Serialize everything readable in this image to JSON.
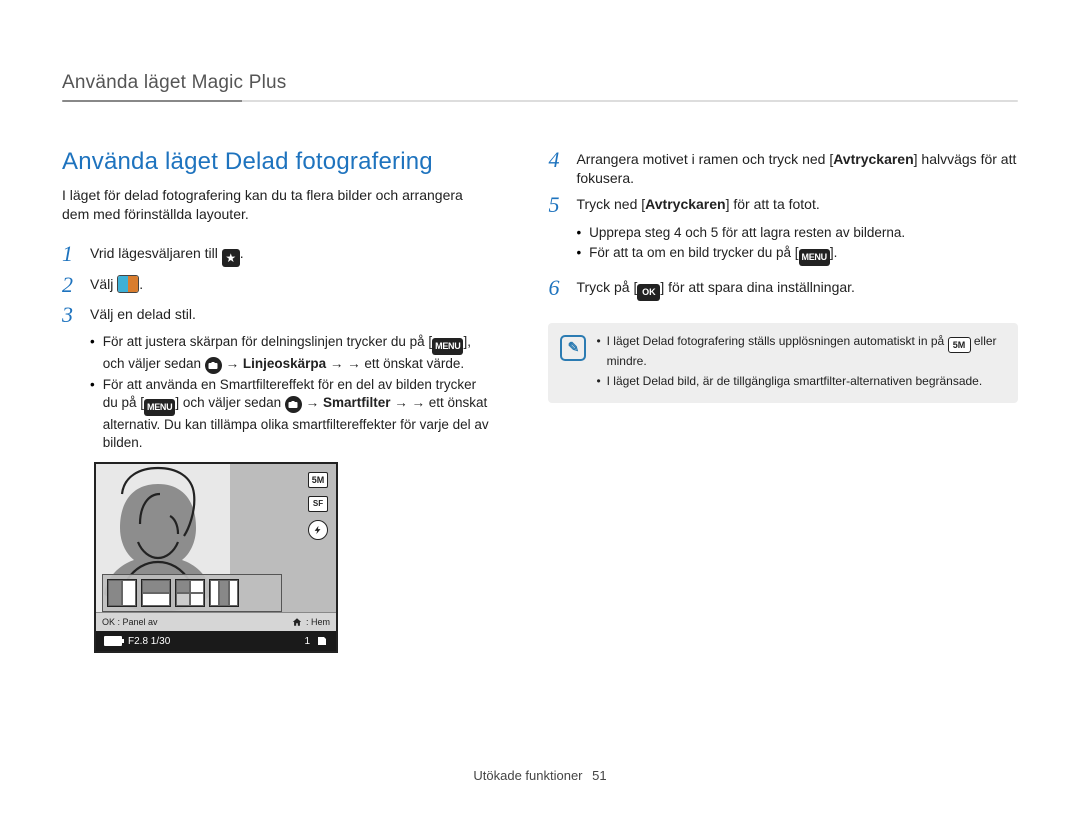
{
  "breadcrumb": "Använda läget Magic Plus",
  "section_title": "Använda läget Delad fotografering",
  "intro": "I läget för delad fotografering kan du ta flera bilder och arrangera dem med förinställda layouter.",
  "steps": {
    "s1": {
      "num": "1",
      "text": "Vrid lägesväljaren till "
    },
    "s2": {
      "num": "2",
      "pre": "Välj ",
      "post": "."
    },
    "s3": {
      "num": "3",
      "text": "Välj en delad stil.",
      "bullets": {
        "b1_pre": "För att justera skärpan för delningslinjen trycker du på [",
        "b1_mid1": "], och väljer sedan ",
        "b1_bold": "Linjeoskärpa",
        "b1_mid2": " → ett önskat värde.",
        "b2_pre": "För att använda en Smartfiltereffekt för en del av bilden trycker du på [",
        "b2_mid1": "] och väljer sedan ",
        "b2_bold": "Smartfilter",
        "b2_mid2": " → ett önskat alternativ. Du kan tillämpa olika smartfiltereffekter för varje del av bilden."
      }
    },
    "s4": {
      "num": "4",
      "pre": "Arrangera motivet i ramen och tryck ned [",
      "bold": "Avtryckaren",
      "post": "] halvvägs för att fokusera."
    },
    "s5": {
      "num": "5",
      "pre": "Tryck ned [",
      "bold": "Avtryckaren",
      "post": "] för att ta fotot.",
      "bullets": {
        "b1": "Upprepa steg 4 och 5 för att lagra resten av bilderna.",
        "b2_pre": "För att ta om en bild trycker du på [",
        "b2_post": "]."
      }
    },
    "s6": {
      "num": "6",
      "pre": "Tryck på [",
      "post": "] för att spara dina inställningar."
    }
  },
  "info": {
    "l1_pre": "I läget Delad fotografering ställs upplösningen automatiskt in på ",
    "l1_5m": "5M",
    "l1_post": " eller mindre.",
    "l2": "I läget Delad bild, är de tillgängliga smartfilter-alternativen begränsade."
  },
  "lcd": {
    "ok_label": "OK : Panel av",
    "home_label": ": Hem",
    "exposure": "F2.8 1/30",
    "count": "1",
    "icon_5m": "5M",
    "icon_sf": "SF"
  },
  "icons": {
    "menu": "MENU",
    "ok": "OK",
    "star": "★",
    "arrow": "→",
    "note": "✎"
  },
  "footer": {
    "section": "Utökade funktioner",
    "page": "51"
  }
}
